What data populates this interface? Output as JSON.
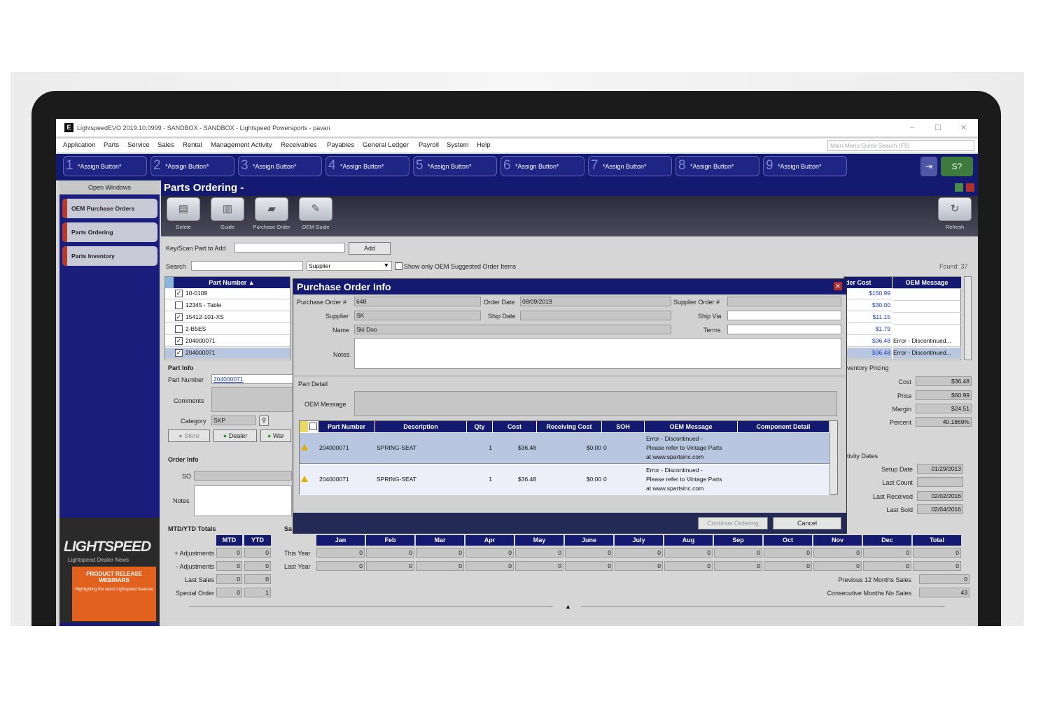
{
  "window": {
    "title": "LightspeedEVO 2019.10.0999 - SANDBOX - SANDBOX - Lightspeed Powersports - pavan",
    "app_icon_glyph": "E",
    "controls": [
      "–",
      "☐",
      "✕"
    ]
  },
  "menu": {
    "items": [
      "Application",
      "Parts",
      "Service",
      "Sales",
      "Rental",
      "Management Activity",
      "Receivables",
      "Payables",
      "General Ledger",
      "Payroll",
      "System",
      "Help"
    ],
    "quick_search_placeholder": "Main Menu Quick Search (F9)"
  },
  "assign_buttons": [
    {
      "n": "1",
      "label": "*Assign Button*"
    },
    {
      "n": "2",
      "label": "*Assign Button*"
    },
    {
      "n": "3",
      "label": "*Assign Button*"
    },
    {
      "n": "4",
      "label": "*Assign Button*"
    },
    {
      "n": "5",
      "label": "*Assign Button*"
    },
    {
      "n": "6",
      "label": "*Assign Button*"
    },
    {
      "n": "7",
      "label": "*Assign Button*"
    },
    {
      "n": "8",
      "label": "*Assign Button*"
    },
    {
      "n": "9",
      "label": "*Assign Button*"
    }
  ],
  "sidebar": {
    "header": "Open Windows",
    "items": [
      "OEM Purchase Orders",
      "Parts Ordering",
      "Parts Inventory"
    ],
    "promo": {
      "brand": "LIGHTSPEED",
      "subtitle": "Lightspeed Dealer News",
      "card_title": "PRODUCT RELEASE WEBINARS",
      "card_text": "Highlighting the latest Lightspeed features"
    }
  },
  "page": {
    "title": "Parts Ordering -",
    "toolbar": [
      {
        "label": "Delete",
        "icon": "printer-icon"
      },
      {
        "label": "Guide",
        "icon": "chart-icon"
      },
      {
        "label": "Purchase Order",
        "icon": "folder-icon"
      },
      {
        "label": "OEM Guide",
        "icon": "edit-icon"
      }
    ],
    "refresh_label": "Refresh",
    "key_label": "Key/Scan Part to Add",
    "add_label": "Add",
    "search_label": "Search",
    "supplier_select": "Supplier",
    "show_oem_label": "Show only OEM Suggested Order Items",
    "found": "Found: 37",
    "grid": {
      "part_header": "Part Number ▲",
      "rows": [
        {
          "checked": true,
          "part": "10-0109"
        },
        {
          "checked": false,
          "part": "12345 - Table"
        },
        {
          "checked": true,
          "part": "15412-101-XS"
        },
        {
          "checked": false,
          "part": "2-B5ES"
        },
        {
          "checked": true,
          "part": "204000071"
        },
        {
          "checked": true,
          "part": "204000071"
        }
      ],
      "right_headers": [
        "der Cost",
        "OEM Message"
      ],
      "right_rows": [
        {
          "cost": "$150.99",
          "msg": ""
        },
        {
          "cost": "$30.00",
          "msg": ""
        },
        {
          "cost": "$11.15",
          "msg": ""
        },
        {
          "cost": "$1.79",
          "msg": ""
        },
        {
          "cost": "$36.48",
          "msg": "Error - Discontinued..."
        },
        {
          "cost": "$36.48",
          "msg": "Error - Discontinued..."
        }
      ]
    },
    "part_info": {
      "header": "Part Info",
      "part_number_label": "Part Number",
      "part_number": "204000071",
      "comments_label": "Comments",
      "category_label": "Category",
      "category": "SKP",
      "store": "Store",
      "dealer": "Dealer",
      "war": "War"
    },
    "order_info": {
      "header": "Order Info",
      "so_label": "SO",
      "notes_label": "Notes"
    },
    "inventory_pricing": {
      "header": "ventory Pricing",
      "rows": [
        {
          "label": "Cost",
          "value": "$36.48"
        },
        {
          "label": "Price",
          "value": "$60.99"
        },
        {
          "label": "Margin",
          "value": "$24.51"
        },
        {
          "label": "Percent",
          "value": "40.1869%"
        }
      ]
    },
    "activity_dates": {
      "header": "tivity Dates",
      "rows": [
        {
          "label": "Setup Date",
          "value": "01/29/2013"
        },
        {
          "label": "Last Count",
          "value": ""
        },
        {
          "label": "Last Received",
          "value": "02/02/2016"
        },
        {
          "label": "Last Sold",
          "value": "02/04/2016"
        }
      ]
    },
    "mtd_ytd": {
      "header": "MTD/YTD Totals",
      "cols": [
        "MTD",
        "YTD"
      ],
      "rows": [
        {
          "label": "+ Adjustments",
          "mtd": "0",
          "ytd": "0"
        },
        {
          "label": "- Adjustments",
          "mtd": "0",
          "ytd": "0"
        },
        {
          "label": "Last Sales",
          "mtd": "0",
          "ytd": "0"
        },
        {
          "label": "Special Order",
          "mtd": "0",
          "ytd": "1"
        }
      ]
    },
    "sales_months": {
      "header": "Sa",
      "months": [
        "Jan",
        "Feb",
        "Mar",
        "Apr",
        "May",
        "June",
        "July",
        "Aug",
        "Sep",
        "Oct",
        "Nov",
        "Dec",
        "Total"
      ],
      "rows": [
        {
          "label": "This Year",
          "values": [
            "0",
            "0",
            "0",
            "0",
            "0",
            "0",
            "0",
            "0",
            "0",
            "0",
            "0",
            "0",
            "0"
          ]
        },
        {
          "label": "Last Year",
          "values": [
            "0",
            "0",
            "0",
            "0",
            "0",
            "0",
            "0",
            "0",
            "0",
            "0",
            "0",
            "0",
            "0"
          ]
        }
      ],
      "prev12_label": "Previous 12 Months Sales",
      "prev12": "0",
      "nosales_label": "Consecutive Months No Sales",
      "nosales": "43"
    }
  },
  "dialog": {
    "title": "Purchase Order Info",
    "po_label": "Purchase Order #",
    "po": "648",
    "order_date_label": "Order Date",
    "order_date": "08/09/2019",
    "supplier_order_label": "Supplier Order #",
    "supplier_order": "",
    "supplier_label": "Supplier",
    "supplier": "SK",
    "ship_date_label": "Ship Date",
    "ship_date": "",
    "ship_via_label": "Ship Via",
    "ship_via": "",
    "name_label": "Name",
    "name": "Ski Doo",
    "terms_label": "Terms",
    "terms": "",
    "notes_label": "Notes",
    "part_detail_label": "Part Detail",
    "oem_message_label": "OEM Message",
    "columns": [
      "Part Number",
      "Description",
      "Qty",
      "Cost",
      "Receiving Cost",
      "SOH",
      "OEM Message",
      "Component Detail"
    ],
    "rows": [
      {
        "part": "204000071",
        "desc": "SPRING-SEAT",
        "qty": "1",
        "cost": "$36.48",
        "recv": "$0.00",
        "soh": "0",
        "msg": [
          "Error - Discontinued -",
          "Please refer to Vintage Parts",
          "at www.spartsinc.com"
        ],
        "comp": ""
      },
      {
        "part": "204000071",
        "desc": "SPRING-SEAT",
        "qty": "1",
        "cost": "$36.48",
        "recv": "$0.00",
        "soh": "0",
        "msg": [
          "Error - Discontinued -",
          "Please refer to Vintage Parts",
          "at www.spartsinc.com"
        ],
        "comp": ""
      }
    ],
    "continue_label": "Continue Ordering",
    "cancel_label": "Cancel"
  },
  "colors": {
    "navy": "#131a6f",
    "sidebar": "#1a1d7c",
    "row_selected": "#b8c6e0",
    "warning": "#e0b000",
    "close_red": "#b03030"
  }
}
